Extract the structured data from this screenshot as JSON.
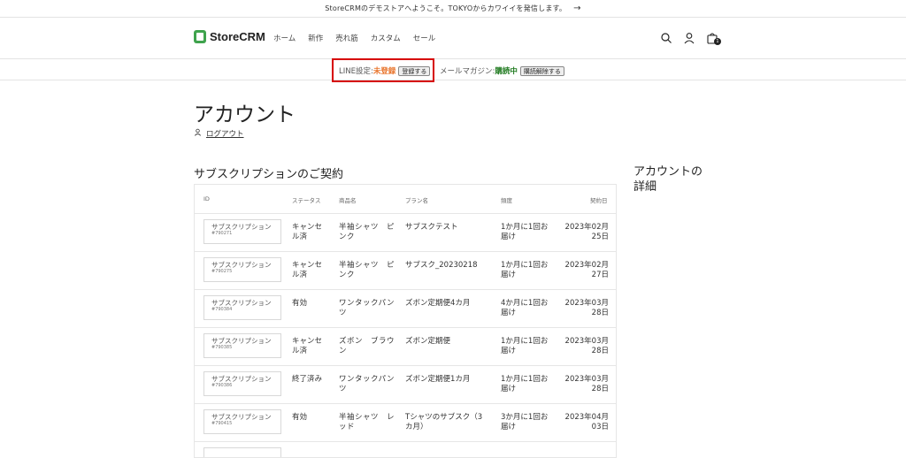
{
  "announcement": {
    "text": "StoreCRMのデモストアへようこそ。TOKYOからカワイイを発信します。",
    "arrow": "→"
  },
  "header": {
    "logo": "StoreCRM",
    "nav": [
      "ホーム",
      "新作",
      "売れ筋",
      "カスタム",
      "セール"
    ],
    "cart_count": "1",
    "icons": [
      "search-icon",
      "account-icon",
      "cart-icon"
    ]
  },
  "line_band": {
    "line_label": "LINE設定: ",
    "line_status": "未登録",
    "line_button": "登録する",
    "mail_label": "メールマガジン: ",
    "mail_status": "購読中",
    "mail_button": "購読解除する"
  },
  "page": {
    "title": "アカウント",
    "logout": "ログアウト",
    "subscriptions_title": "サブスクリプションのご契約",
    "account_details_title": "アカウントの詳細"
  },
  "table": {
    "headers": [
      "ID",
      "ステータス",
      "商品名",
      "プラン名",
      "頻度",
      "契約日"
    ],
    "rows": [
      {
        "id_label": "サブスクリプション",
        "id_number": "#790271",
        "status": "キャンセル済",
        "product": "半袖シャツ　ピンク",
        "plan": "サブスクテスト",
        "frequency": "1か月に1回お届け",
        "date": "2023年02月25日"
      },
      {
        "id_label": "サブスクリプション",
        "id_number": "#790275",
        "status": "キャンセル済",
        "product": "半袖シャツ　ピンク",
        "plan": "サブスク_20230218",
        "frequency": "1か月に1回お届け",
        "date": "2023年02月27日"
      },
      {
        "id_label": "サブスクリプション",
        "id_number": "#790384",
        "status": "有効",
        "product": "ワンタックパンツ",
        "plan": "ズボン定期便4カ月",
        "frequency": "4か月に1回お届け",
        "date": "2023年03月28日"
      },
      {
        "id_label": "サブスクリプション",
        "id_number": "#790385",
        "status": "キャンセル済",
        "product": "ズボン　ブラウン",
        "plan": "ズボン定期便",
        "frequency": "1か月に1回お届け",
        "date": "2023年03月28日"
      },
      {
        "id_label": "サブスクリプション",
        "id_number": "#790386",
        "status": "終了済み",
        "product": "ワンタックパンツ",
        "plan": "ズボン定期便1カ月",
        "frequency": "1か月に1回お届け",
        "date": "2023年03月28日"
      },
      {
        "id_label": "サブスクリプション",
        "id_number": "#790415",
        "status": "有効",
        "product": "半袖シャツ　レッド",
        "plan": "Tシャツのサブスク（3カ月）",
        "frequency": "3か月に1回お届け",
        "date": "2023年04月03日"
      }
    ]
  },
  "colors": {
    "highlight_box": "#d60000",
    "unregistered": "#e8742b",
    "subscribed": "#1f7a1f",
    "logo": "#3fa34d"
  }
}
